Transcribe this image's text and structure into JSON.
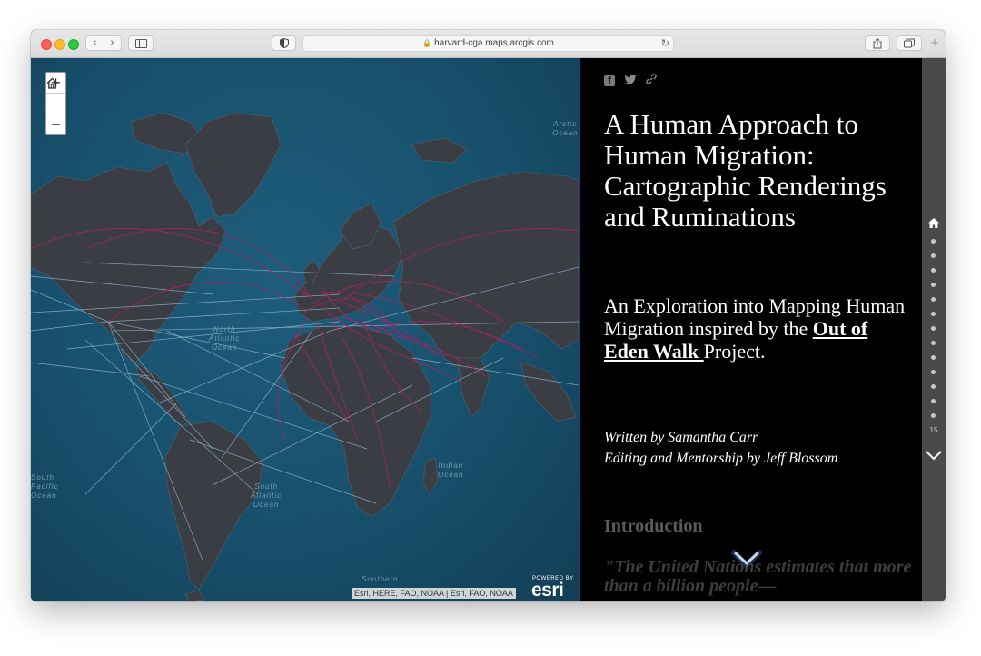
{
  "browser": {
    "url": "harvard-cga.maps.arcgis.com",
    "back_glyph": "‹",
    "forward_glyph": "›",
    "new_tab_glyph": "+"
  },
  "map": {
    "zoom_in": "+",
    "zoom_out": "−",
    "ocean_labels": {
      "arctic": "Arctic\nOcean",
      "north_atlantic": "North\nAtlantic\nOcean",
      "indian": "Indian\nOcean",
      "south_atlantic": "South\nAtlantic\nOcean",
      "southern": "Southern",
      "south_pacific": "South\nPacific\nOcean"
    },
    "attribution": "Esri, HERE, FAO, NOAA | Esri, FAO, NOAA",
    "powered_by": "POWERED BY",
    "logo": "esri"
  },
  "story": {
    "title": "A Human Approach to Human Migration: Cartographic Renderings and Ruminations",
    "subtitle_prefix": "An Exploration into Mapping Human Migration inspired by the ",
    "subtitle_link": "Out of Eden Walk ",
    "subtitle_suffix": "Project.",
    "byline_author": "Written by Samantha Carr",
    "byline_editor": "Editing and Mentorship by Jeff Blossom",
    "section_heading": "Introduction",
    "quote_preview": "\"The United Nations estimates that more than a billion people—"
  },
  "rail": {
    "page_count": "15"
  },
  "colors": {
    "ocean": "#18506c",
    "land": "#3a3e44",
    "migration_line": "#b31f63",
    "route_line": "#9fc3de",
    "rail": "#4a4a4a"
  }
}
